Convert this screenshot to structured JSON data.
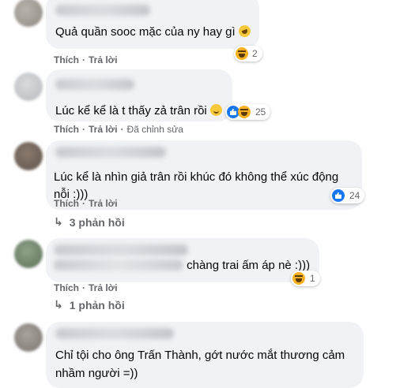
{
  "labels": {
    "like": "Thích",
    "reply": "Trả lời",
    "dot": "·",
    "edited": "Đã chỉnh sửa"
  },
  "comments": [
    {
      "text": "Quả quần sooc mặc của ny hay gì",
      "inline_emoji": "rofl-emoji",
      "reaction_icons": [
        "haha"
      ],
      "reaction_count": "2"
    },
    {
      "text": "Lúc kể kể là t thấy zả trân rồi",
      "inline_emoji": "smile-emoji",
      "reaction_icons": [
        "like",
        "haha"
      ],
      "reaction_count": "25",
      "edited": true
    },
    {
      "text_line1": "Lúc kể là nhìn giả trân rồi khúc đó không thể xúc động",
      "text_line2": "nỗi :)))",
      "reaction_icons": [
        "like"
      ],
      "reaction_count": "24",
      "replies": "3 phản hồi"
    },
    {
      "text": "chàng trai ấm áp nè :)))",
      "reaction_icons": [
        "haha"
      ],
      "reaction_count": "1",
      "replies": "1 phản hồi"
    },
    {
      "text_line1": "Chỉ tội cho ông Trấn Thành, gớt nước mắt thương cảm",
      "text_line2": "nhầm người =))"
    }
  ],
  "colors": {
    "bubble": "#f0f2f5",
    "meta_text": "#65676b",
    "like_blue": "#1877f2",
    "haha_yellow": "#f7b125"
  }
}
